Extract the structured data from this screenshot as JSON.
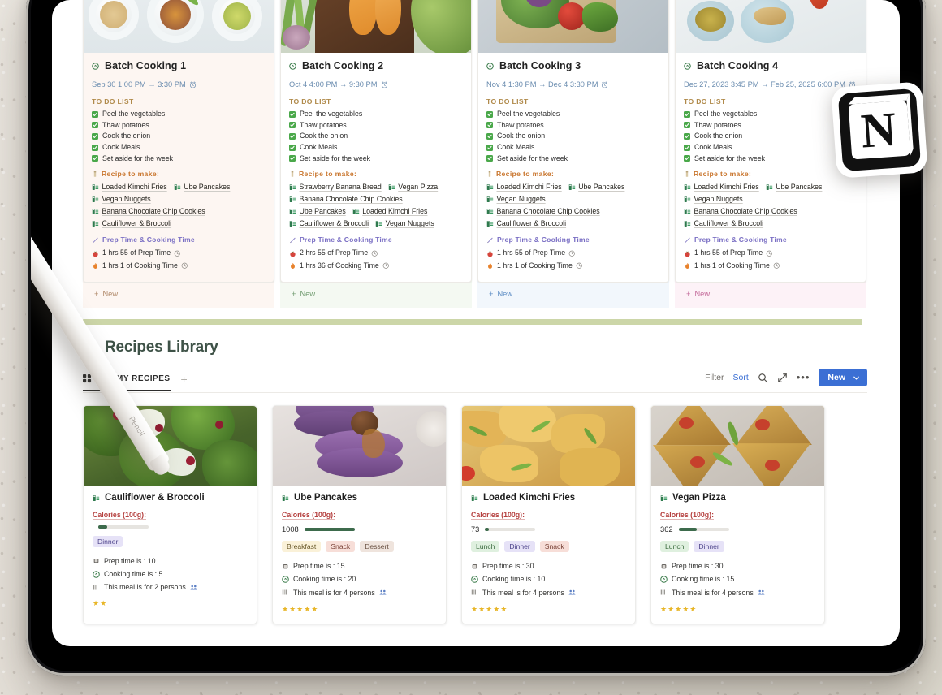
{
  "board": {
    "columns": [
      {
        "title": "Batch Cooking 1",
        "accent": "#b0896a",
        "date": "Sep 30 1:00 PM → 3:30 PM",
        "todo_label": "TO DO LIST",
        "todo": [
          "Peel the vegetables",
          "Thaw potatoes",
          "Cook the onion",
          "Cook Meals",
          "Set aside for the week"
        ],
        "recipe_label": "Recipe to make:",
        "recipes": [
          [
            "Loaded Kimchi Fries",
            "Ube Pancakes"
          ],
          [
            "Vegan Nuggets"
          ],
          [
            "Banana Chocolate Chip Cookies"
          ],
          [
            "Cauliflower & Broccoli"
          ]
        ],
        "time_label": "Prep Time & Cooking Time",
        "prep_time": "1 hrs 55 of Prep Time",
        "cook_time": "1 hrs 1 of Cooking Time",
        "new_label": "New"
      },
      {
        "title": "Batch Cooking 2",
        "accent": "#6e9a6e",
        "date": "Oct 4 4:00 PM → 9:30 PM",
        "todo_label": "TO DO LIST",
        "todo": [
          "Peel the vegetables",
          "Thaw potatoes",
          "Cook the onion",
          "Cook Meals",
          "Set aside for the week"
        ],
        "recipe_label": "Recipe to make:",
        "recipes": [
          [
            "Strawberry Banana Bread",
            "Vegan Pizza"
          ],
          [
            "Banana Chocolate Chip Cookies"
          ],
          [
            "Ube Pancakes",
            "Loaded Kimchi Fries"
          ],
          [
            "Cauliflower & Broccoli",
            "Vegan Nuggets"
          ]
        ],
        "time_label": "Prep Time & Cooking Time",
        "prep_time": "2 hrs 55 of Prep Time",
        "cook_time": "1 hrs 36 of Cooking Time",
        "new_label": "New"
      },
      {
        "title": "Batch Cooking 3",
        "accent": "#5c8cc4",
        "date": "Nov 4 1:30 PM → Dec 4 3:30 PM",
        "todo_label": "TO DO LIST",
        "todo": [
          "Peel the vegetables",
          "Thaw potatoes",
          "Cook the onion",
          "Cook Meals",
          "Set aside for the week"
        ],
        "recipe_label": "Recipe to make:",
        "recipes": [
          [
            "Loaded Kimchi Fries",
            "Ube Pancakes"
          ],
          [
            "Vegan Nuggets"
          ],
          [
            "Banana Chocolate Chip Cookies"
          ],
          [
            "Cauliflower & Broccoli"
          ]
        ],
        "time_label": "Prep Time & Cooking Time",
        "prep_time": "1 hrs 55 of Prep Time",
        "cook_time": "1 hrs 1 of Cooking Time",
        "new_label": "New"
      },
      {
        "title": "Batch Cooking 4",
        "accent": "#c46a9a",
        "date": "Dec 27, 2023 3:45 PM → Feb 25, 2025 6:00 PM",
        "todo_label": "TO DO LIST",
        "todo": [
          "Peel the vegetables",
          "Thaw potatoes",
          "Cook the onion",
          "Cook Meals",
          "Set aside for the week"
        ],
        "recipe_label": "Recipe to make:",
        "recipes": [
          [
            "Loaded Kimchi Fries",
            "Ube Pancakes"
          ],
          [
            "Vegan Nuggets"
          ],
          [
            "Banana Chocolate Chip Cookies"
          ],
          [
            "Cauliflower & Broccoli"
          ]
        ],
        "time_label": "Prep Time & Cooking Time",
        "prep_time": "1 hrs 55 of Prep Time",
        "cook_time": "1 hrs 1 of Cooking Time",
        "new_label": "New"
      }
    ]
  },
  "library": {
    "icon": "frying-pan-icon",
    "title": "Recipes Library",
    "tab": {
      "label": "ALL MY RECIPES",
      "icon": "grid-view-icon"
    },
    "add_tab": "+",
    "toolbar": {
      "filter": "Filter",
      "sort": "Sort",
      "search_icon": "search-icon",
      "expand_icon": "expand-icon",
      "more_icon": "more-options-icon",
      "new": "New",
      "new_caret": "chevron-down-icon",
      "accent": "#3b6fd4"
    },
    "cards": [
      {
        "title": "Cauliflower & Broccoli",
        "calories_label": "Calories (100g):",
        "calories": "",
        "calories_pct": 18,
        "tags": [
          {
            "label": "Dinner",
            "kind": "dinner"
          }
        ],
        "prep": "Prep time is : 10",
        "cook": "Cooking time is : 5",
        "persons": "This meal is for 2 persons",
        "stars": "★★"
      },
      {
        "title": "Ube Pancakes",
        "calories_label": "Calories (100g):",
        "calories": "1008",
        "calories_pct": 100,
        "tags": [
          {
            "label": "Breakfast",
            "kind": "breakfast"
          },
          {
            "label": "Snack",
            "kind": "snack"
          },
          {
            "label": "Dessert",
            "kind": "dessert"
          }
        ],
        "prep": "Prep time is : 15",
        "cook": "Cooking time is : 20",
        "persons": "This meal is for 4 persons",
        "stars": "★★★★★"
      },
      {
        "title": "Loaded Kimchi Fries",
        "calories_label": "Calories (100g):",
        "calories": "73",
        "calories_pct": 7,
        "tags": [
          {
            "label": "Lunch",
            "kind": "lunch"
          },
          {
            "label": "Dinner",
            "kind": "dinner"
          },
          {
            "label": "Snack",
            "kind": "snack"
          }
        ],
        "prep": "Prep time is : 30",
        "cook": "Cooking time is : 10",
        "persons": "This meal is for 4 persons",
        "stars": "★★★★★"
      },
      {
        "title": "Vegan Pizza",
        "calories_label": "Calories (100g):",
        "calories": "362",
        "calories_pct": 36,
        "tags": [
          {
            "label": "Lunch",
            "kind": "lunch"
          },
          {
            "label": "Dinner",
            "kind": "dinner"
          }
        ],
        "prep": "Prep time is : 30",
        "cook": "Cooking time is : 15",
        "persons": "This meal is for 4 persons",
        "stars": "★★★★★"
      }
    ]
  },
  "decor": {
    "notion_logo": "notion-logo",
    "pencil_label": "Pencil",
    "divider_color": "#ccd6a8"
  }
}
